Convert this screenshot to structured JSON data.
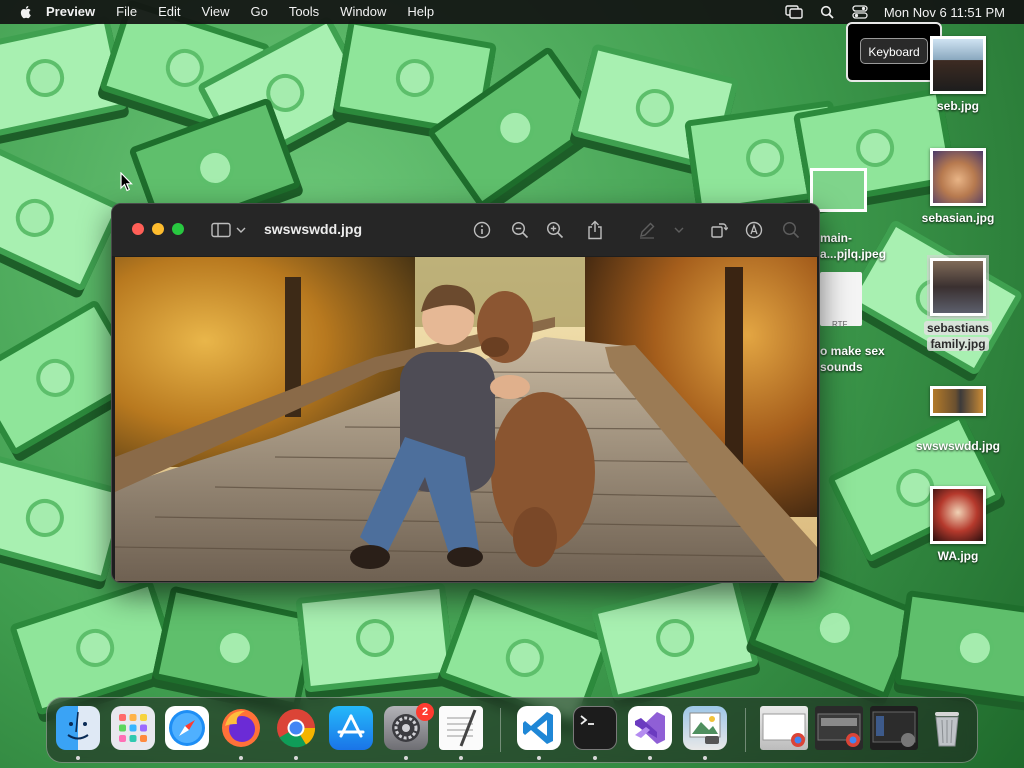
{
  "menubar": {
    "app_name": "Preview",
    "items": [
      "File",
      "Edit",
      "View",
      "Go",
      "Tools",
      "Window",
      "Help"
    ],
    "clock": "Mon Nov 6  11:51 PM",
    "icons": [
      "screen-mirroring-icon",
      "spotlight-search-icon",
      "control-center-icon"
    ]
  },
  "keyboard_hud": {
    "label": "Keyboard"
  },
  "desktop": {
    "icons": [
      {
        "name": "seb.jpg"
      },
      {
        "name": "sebasian.jpg"
      },
      {
        "name": "sebastians family.jpg",
        "line1": "sebastians",
        "line2": "family.jpg",
        "selected": true
      },
      {
        "name": "swswswdd.jpg"
      },
      {
        "name": "WA.jpg"
      }
    ],
    "partial_icons": [
      {
        "line1": "main-",
        "line2": "...pjlq.jpeg",
        "prefix": "a"
      },
      {
        "line1": "o make sex",
        "line2": "sounds",
        "type_label": "RTF"
      }
    ]
  },
  "preview": {
    "title": "swswswdd.jpg",
    "toolbar_icons": [
      "sidebar-toggle-icon",
      "chevron-down-icon",
      "info-icon",
      "zoom-out-icon",
      "zoom-in-icon",
      "share-icon",
      "markup-pen-icon",
      "chevron-down-icon",
      "rotate-icon",
      "markup-icon",
      "search-icon"
    ]
  },
  "dock": {
    "apps": [
      "Finder",
      "Launchpad",
      "Safari",
      "Firefox",
      "Google Chrome",
      "App Store",
      "System Settings",
      "TextEdit",
      "Visual Studio Code",
      "Terminal",
      "Visual Studio",
      "Preview"
    ],
    "settings_badge": "2",
    "trash": "Trash"
  },
  "colors": {
    "close": "#ff5f57",
    "minimize": "#febc2e",
    "zoom": "#28c840"
  }
}
